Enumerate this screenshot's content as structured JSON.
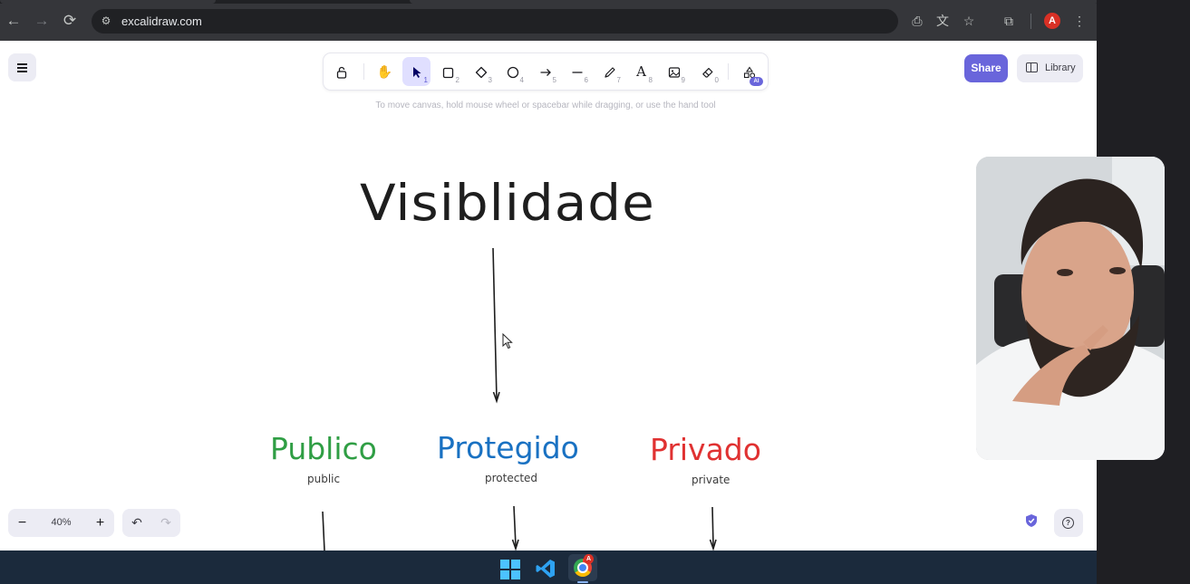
{
  "browser": {
    "url": "excalidraw.com",
    "profile_initial": "A",
    "nav": {
      "back": "back-arrow-icon",
      "forward": "forward-arrow-icon",
      "reload": "reload-icon"
    },
    "toolbar_icons": [
      "install-app-icon",
      "translate-icon",
      "bookmark-star-icon",
      "extensions-icon",
      "kebab-menu-icon"
    ]
  },
  "excalidraw": {
    "toolbar": {
      "tools": [
        {
          "name": "lock",
          "icon": "lock-icon",
          "key": ""
        },
        {
          "name": "hand",
          "icon": "hand-icon",
          "key": ""
        },
        {
          "name": "selection",
          "icon": "pointer-icon",
          "key": "1",
          "active": true
        },
        {
          "name": "rectangle",
          "icon": "rectangle-icon",
          "key": "2"
        },
        {
          "name": "diamond",
          "icon": "diamond-icon",
          "key": "3"
        },
        {
          "name": "ellipse",
          "icon": "ellipse-icon",
          "key": "4"
        },
        {
          "name": "arrow",
          "icon": "arrow-icon",
          "key": "5"
        },
        {
          "name": "line",
          "icon": "line-icon",
          "key": "6"
        },
        {
          "name": "draw",
          "icon": "pencil-icon",
          "key": "7"
        },
        {
          "name": "text",
          "icon": "text-icon",
          "key": "8"
        },
        {
          "name": "image",
          "icon": "image-icon",
          "key": "9"
        },
        {
          "name": "eraser",
          "icon": "eraser-icon",
          "key": "0"
        },
        {
          "name": "more-tools",
          "icon": "shapes-icon",
          "key": ""
        }
      ],
      "ai_badge": "AI"
    },
    "hint": "To move canvas, hold mouse wheel or spacebar while dragging, or use the hand tool",
    "share_label": "Share",
    "library_label": "Library",
    "zoom_level": "40%",
    "zoom_minus": "−",
    "zoom_plus": "+"
  },
  "drawing": {
    "title": "Visiblidade",
    "nodes": [
      {
        "label": "Publico",
        "sub": "public",
        "color": "#2f9e44"
      },
      {
        "label": "Protegido",
        "sub": "protected",
        "color": "#1971c2"
      },
      {
        "label": "Privado",
        "sub": "private",
        "color": "#e03131"
      }
    ]
  },
  "taskbar": {
    "apps": [
      "windows-start-icon",
      "vscode-icon",
      "chrome-icon"
    ],
    "chrome_badge": "A"
  },
  "colors": {
    "excalidraw_accent": "#6965db",
    "browser_chrome": "#35363a",
    "taskbar": "#1b2a3c"
  }
}
